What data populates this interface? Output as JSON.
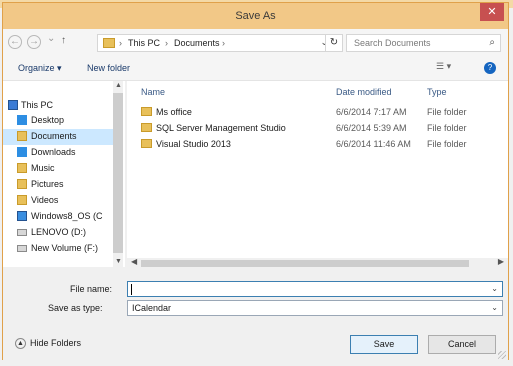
{
  "window": {
    "title": "Save As",
    "close_glyph": "✕"
  },
  "nav": {
    "back": "←",
    "forward": "→",
    "dropdown": "⌄",
    "up": "↑"
  },
  "address": {
    "sep1": "›",
    "crumb1": "This PC",
    "sep2": "›",
    "crumb2": "Documents",
    "sep3": "›",
    "dropdown": "⌄",
    "refresh": "↻"
  },
  "search": {
    "placeholder": "Search Documents",
    "icon": "⌕"
  },
  "toolbar": {
    "organize": "Organize ▾",
    "new_folder": "New folder",
    "view": "☰ ▾",
    "help": "?"
  },
  "sidebar": {
    "items": [
      {
        "label": "This PC"
      },
      {
        "label": "Desktop"
      },
      {
        "label": "Documents"
      },
      {
        "label": "Downloads"
      },
      {
        "label": "Music"
      },
      {
        "label": "Pictures"
      },
      {
        "label": "Videos"
      },
      {
        "label": "Windows8_OS (C"
      },
      {
        "label": "LENOVO (D:)"
      },
      {
        "label": "New Volume (F:)"
      }
    ]
  },
  "columns": {
    "name": "Name",
    "date": "Date modified",
    "type": "Type"
  },
  "files": [
    {
      "name": "Ms office",
      "date": "6/6/2014 7:17 AM",
      "type": "File folder"
    },
    {
      "name": "SQL Server Management Studio",
      "date": "6/6/2014 5:39 AM",
      "type": "File folder"
    },
    {
      "name": "Visual Studio 2013",
      "date": "6/6/2014 11:46 AM",
      "type": "File folder"
    }
  ],
  "form": {
    "file_name_label": "File name:",
    "file_name_value": "",
    "save_type_label": "Save as type:",
    "save_type_value": "ICalendar"
  },
  "footer": {
    "hide_folders": "Hide Folders",
    "save": "Save",
    "cancel": "Cancel"
  }
}
